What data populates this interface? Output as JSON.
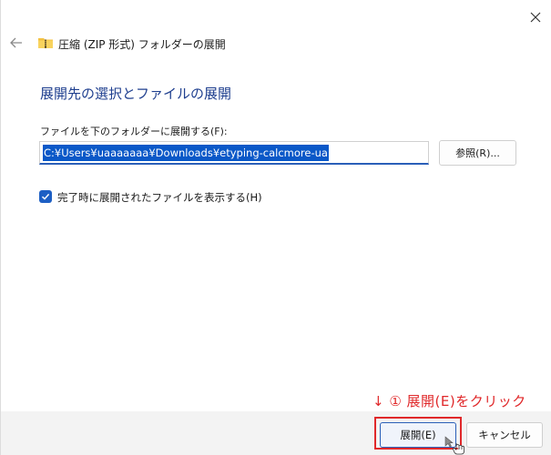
{
  "window": {
    "title": "圧縮 (ZIP 形式) フォルダーの展開"
  },
  "main": {
    "heading": "展開先の選択とファイルの展開",
    "path_label": "ファイルを下のフォルダーに展開する(F):",
    "path_value": "C:¥Users¥uaaaaaaa¥Downloads¥etyping-calcmore-ua",
    "browse_label": "参照(R)...",
    "show_files_label": "完了時に展開されたファイルを表示する(H)",
    "show_files_checked": true
  },
  "annotation": {
    "text": "↓ ① 展開(E)をクリック"
  },
  "footer": {
    "extract_label": "展開(E)",
    "cancel_label": "キャンセル"
  },
  "colors": {
    "accent": "#1d5fc4",
    "annotation": "#e0282a",
    "heading": "#1f3f8f"
  },
  "icons": {
    "close": "close-icon",
    "back": "back-arrow-icon",
    "folder": "zip-folder-icon",
    "check": "checkmark-icon",
    "cursor": "mouse-pointer-icon"
  }
}
